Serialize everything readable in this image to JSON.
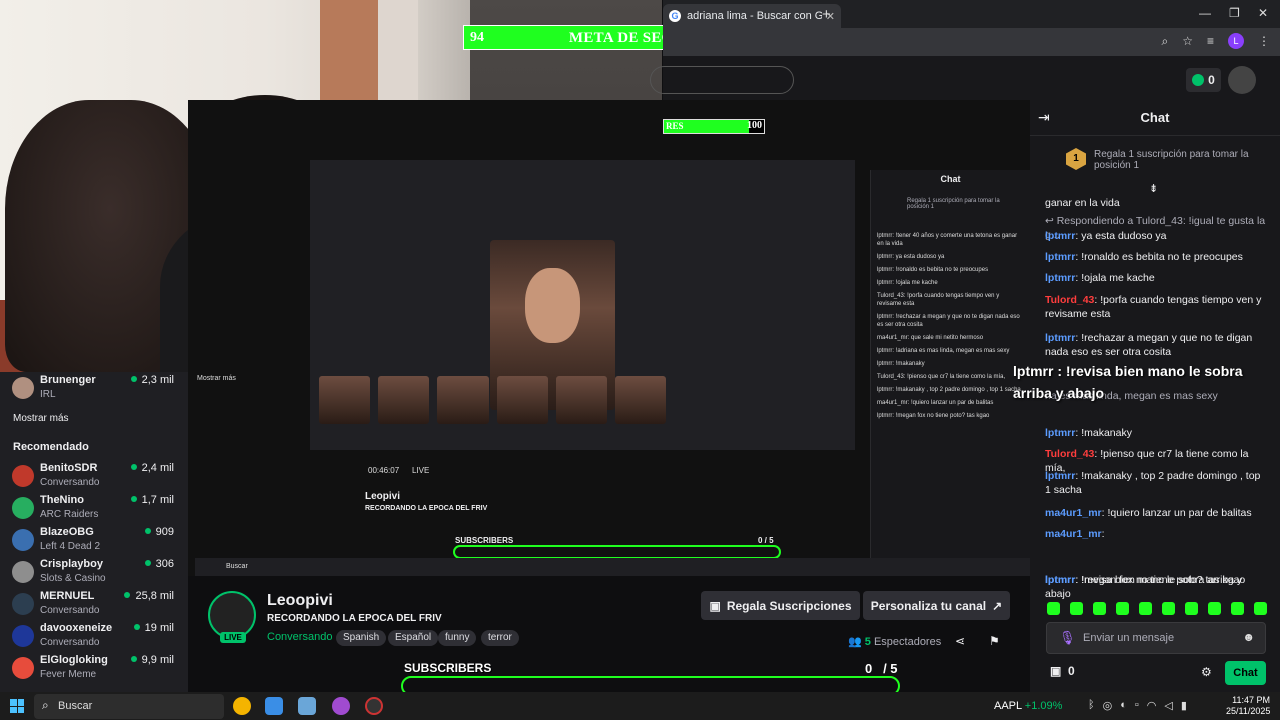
{
  "browser": {
    "tab_title": "adriana lima - Buscar con Goog",
    "new_tab": "+",
    "win_min": "—",
    "win_max": "❐",
    "win_close": "✕",
    "profile_letter": "L"
  },
  "goal": {
    "current": "94",
    "title": "META DE SEGUIDORES",
    "target": "100",
    "progress": 0.94,
    "fill_color": "#1fff1f"
  },
  "nested_goal": {
    "left": "RES",
    "target": "100"
  },
  "coins": "0",
  "sidebar": {
    "top_item": {
      "name": "Brunenger",
      "game": "IRL",
      "viewers": "2,3 mil"
    },
    "show_more": "Mostrar más",
    "recommended_title": "Recomendado",
    "items": [
      {
        "name": "BenitoSDR",
        "game": "Conversando",
        "viewers": "2,4 mil",
        "color": "#c0392b"
      },
      {
        "name": "TheNino",
        "game": "ARC Raiders",
        "viewers": "1,7 mil",
        "color": "#27ae60"
      },
      {
        "name": "BlazeOBG",
        "game": "Left 4 Dead 2",
        "viewers": "909",
        "color": "#3a6fb0"
      },
      {
        "name": "Crisplayboy",
        "game": "Slots & Casino",
        "viewers": "306",
        "color": "#8e8e8e"
      },
      {
        "name": "MERNUEL",
        "game": "Conversando",
        "viewers": "25,8 mil",
        "color": "#2c3e50"
      },
      {
        "name": "davooxeneize",
        "game": "Conversando",
        "viewers": "19 mil",
        "color": "#1e3799"
      },
      {
        "name": "ElGlogloking",
        "game": "Fever Meme",
        "viewers": "9,9 mil",
        "color": "#e74c3c"
      }
    ]
  },
  "nested": {
    "sidebar_title": "Mostrar más",
    "chat_title": "Chat",
    "pin": "Regala 1 suscripción para tomar la posición 1",
    "channel": "Leopivi",
    "stream_title": "RECORDANDO LA EPOCA DEL FRIV",
    "time": "00:46:07",
    "live": "LIVE",
    "search": "Buscar",
    "subs_label": "SUBSCRIBERS",
    "subs_count": "0 / 5",
    "messages": [
      "lptmrr: !tener 40 años y comerte una tetona es ganar en la vida",
      "lptmrr: ya esta dudoso ya",
      "lptmrr: !ronaldo es bebita no te preocupes",
      "lptmrr: !ojala me kache",
      "Tulord_43: !porfa cuando tengas tiempo ven y revisame esta",
      "lptmrr: !rechazar a megan y que no te digan nada eso es ser otra cosita",
      "ma4ur1_mr: que sale mi netito hermoso",
      "lptmrr: !adriana es mas linda, megan es mas sexy",
      "lptmrr: !makanaky",
      "Tulord_43: !pienso que cr7 la tiene como la mía,",
      "lptmrr: !makanaky , top 2 padre domingo , top 1 sacha",
      "ma4ur1_mr: !quiero lanzar un par de balitas",
      "lptmrr: !megan fox no tiene poto? tas kgao"
    ]
  },
  "channel": {
    "name": "Leoopivi",
    "title": "RECORDANDO LA EPOCA DEL FRIV",
    "category": "Conversando",
    "tags": [
      "Spanish",
      "Español",
      "funny",
      "terror"
    ],
    "live_badge": "LIVE",
    "gift_button": "Regala Suscripciones",
    "customize_button": "Personaliza tu canal",
    "viewers_count": "5",
    "viewers_label": "Espectadores",
    "subs_label": "SUBSCRIBERS",
    "subs_current": "0",
    "subs_target": "/ 5"
  },
  "chat": {
    "title": "Chat",
    "pin_rank": "1",
    "pin_text": "Regala 1 suscripción para tomar la posición 1",
    "overlay_message": "lptmrr : !revisa bien mano le sobra arriba y abajo",
    "messages": [
      {
        "user": "",
        "text": "ganar en la vida",
        "color": "#efeff1"
      },
      {
        "user": "",
        "text": "↩ Respondiendo a Tulord_43: !igual te gusta la g...",
        "color": "#adadb8"
      },
      {
        "user": "lptmrr",
        "text": "ya esta dudoso ya",
        "color": "#5c9cff"
      },
      {
        "user": "lptmrr",
        "text": "!ronaldo es bebita no te preocupes",
        "color": "#5c9cff"
      },
      {
        "user": "lptmrr",
        "text": "!ojala me kache",
        "color": "#5c9cff"
      },
      {
        "user": "Tulord_43",
        "text": "!porfa cuando tengas tiempo ven y revisame esta",
        "color": "#ff3d3d"
      },
      {
        "user": "lptmrr",
        "text": "!rechazar a megan y que no te digan nada eso es ser otra cosita",
        "color": "#5c9cff"
      },
      {
        "user": "",
        "text": "na es mas linda, megan es mas sexy",
        "color": "#adadb8"
      },
      {
        "user": "lptmrr",
        "text": "!makanaky",
        "color": "#5c9cff"
      },
      {
        "user": "Tulord_43",
        "text": "!pienso que cr7 la tiene como la mía,",
        "color": "#ff3d3d"
      },
      {
        "user": "lptmrr",
        "text": "!makanaky , top 2 padre domingo , top 1 sacha",
        "color": "#5c9cff"
      },
      {
        "user": "ma4ur1_mr",
        "text": "!quiero lanzar un par de balitas",
        "color": "#5c9cff"
      },
      {
        "user": "ma4ur1_mr",
        "text": "",
        "color": "#5c9cff"
      },
      {
        "user": "lptmrr",
        "text": "!megan fox no tiene poto? tas kgao",
        "color": "#5c9cff"
      },
      {
        "user": "lptmrr",
        "text": "!revisa bien mano le sobra arriba y abajo",
        "color": "#5c9cff"
      }
    ],
    "input_placeholder": "Enviar un mensaje",
    "points": "0",
    "send_button": "Chat"
  },
  "taskbar": {
    "search_placeholder": "Buscar",
    "ticker_symbol": "AAPL",
    "ticker_change": "+1.09%",
    "time": "11:47 PM",
    "date": "25/11/2025"
  }
}
